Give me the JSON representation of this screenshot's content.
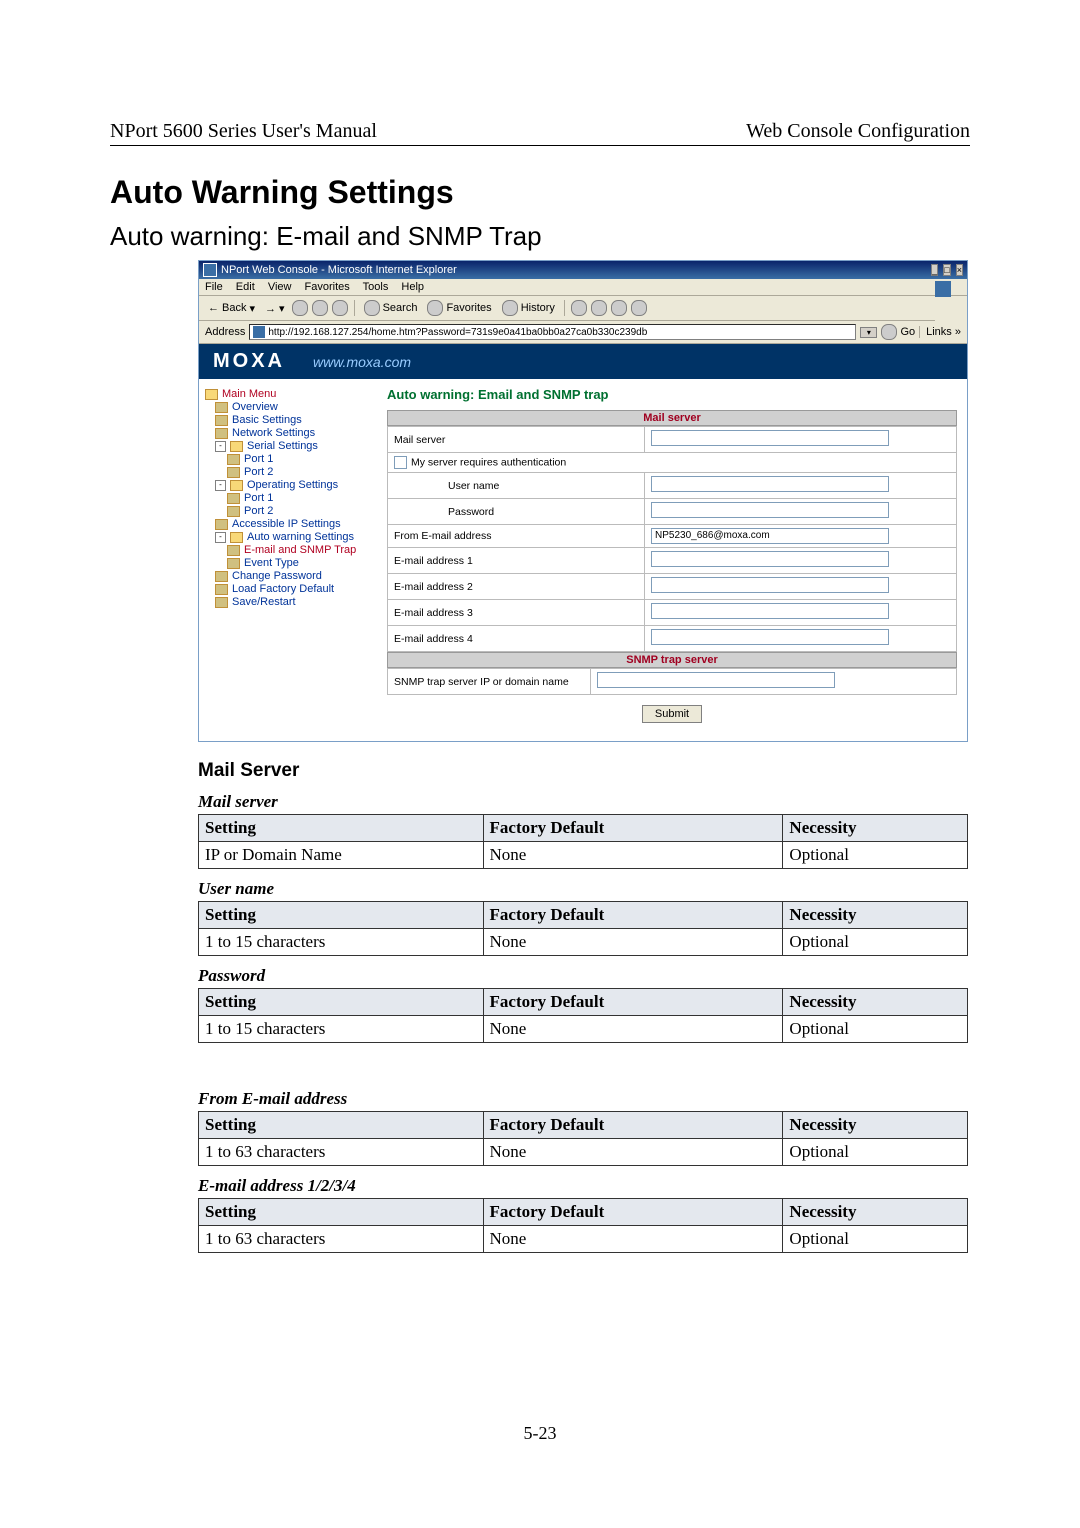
{
  "header": {
    "left": "NPort 5600 Series User's Manual",
    "right": "Web Console Configuration"
  },
  "h1": "Auto Warning Settings",
  "h2": "Auto warning: E-mail and SNMP Trap",
  "h3": "Mail Server",
  "tableHeaders": {
    "c1": "Setting",
    "c2": "Factory Default",
    "c3": "Necessity"
  },
  "tables": {
    "mailserver": {
      "label": "Mail server",
      "setting": "IP or Domain Name",
      "def": "None",
      "nec": "Optional"
    },
    "username": {
      "label": "User name",
      "setting": "1 to 15 characters",
      "def": "None",
      "nec": "Optional"
    },
    "password": {
      "label": "Password",
      "setting": "1 to 15 characters",
      "def": "None",
      "nec": "Optional"
    },
    "from": {
      "label": "From E-mail address",
      "setting": "1 to 63 characters",
      "def": "None",
      "nec": "Optional"
    },
    "addr": {
      "label": "E-mail address 1/2/3/4",
      "setting": "1 to 63 characters",
      "def": "None",
      "nec": "Optional"
    }
  },
  "shot": {
    "title": "NPort Web Console - Microsoft Internet Explorer",
    "win": {
      "min": "_",
      "max": "□",
      "close": "×"
    },
    "menu": [
      "File",
      "Edit",
      "View",
      "Favorites",
      "Tools",
      "Help"
    ],
    "toolbar": {
      "back": "Back",
      "search": "Search",
      "fav": "Favorites",
      "history": "History"
    },
    "address": {
      "label": "Address",
      "value": "http://192.168.127.254/home.htm?Password=731s9e0a41ba0bb0a27ca0b330c239db",
      "go": "Go",
      "links": "Links"
    },
    "brand": "MOXA",
    "brand_url": "www.moxa.com",
    "menu_root": "Main Menu",
    "side": {
      "overview": "Overview",
      "basic": "Basic Settings",
      "network": "Network Settings",
      "serial": "Serial Settings",
      "p1": "Port 1",
      "p2": "Port 2",
      "operating": "Operating Settings",
      "accessible": "Accessible IP Settings",
      "autow": "Auto warning Settings",
      "email_snmp": "E-mail and SNMP Trap",
      "event": "Event Type",
      "chpw": "Change Password",
      "loaddef": "Load Factory Default",
      "save": "Save/Restart"
    },
    "ctitle": "Auto warning: Email and SNMP trap",
    "sect_mail": "Mail server",
    "sect_snmp": "SNMP trap server",
    "form": {
      "mailserver": "Mail server",
      "auth": "My server requires authentication",
      "user": "User name",
      "pass": "Password",
      "from": "From E-mail address",
      "from_val": "NP5230_686@moxa.com",
      "e1": "E-mail address 1",
      "e2": "E-mail address 2",
      "e3": "E-mail address 3",
      "e4": "E-mail address 4",
      "snmp": "SNMP trap server IP or domain name",
      "submit": "Submit"
    }
  },
  "pagenum": "5-23"
}
